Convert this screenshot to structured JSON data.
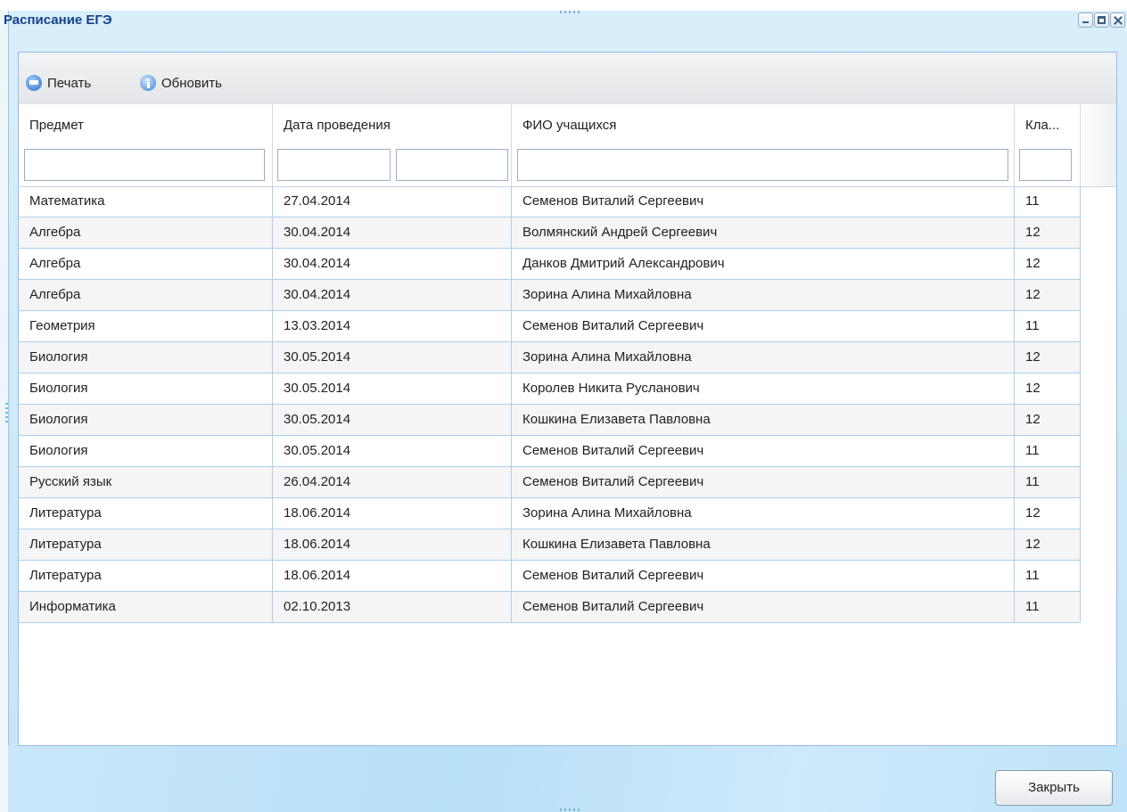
{
  "window": {
    "title": "Расписание ЕГЭ"
  },
  "toolbar": {
    "print_label": "Печать",
    "refresh_label": "Обновить"
  },
  "grid": {
    "columns": [
      "Предмет",
      "Дата проведения",
      "ФИО учащихся",
      "Кла..."
    ],
    "filters": {
      "subject": "",
      "date_from": "",
      "date_to": "",
      "student": "",
      "class": ""
    },
    "rows": [
      {
        "subject": "Математика",
        "date": "27.04.2014",
        "student": "Семенов Виталий Сергеевич",
        "class": "11"
      },
      {
        "subject": "Алгебра",
        "date": "30.04.2014",
        "student": "Волмянский Андрей Сергеевич",
        "class": "12"
      },
      {
        "subject": "Алгебра",
        "date": "30.04.2014",
        "student": "Данков Дмитрий Александрович",
        "class": "12"
      },
      {
        "subject": "Алгебра",
        "date": "30.04.2014",
        "student": "Зорина Алина Михайловна",
        "class": "12"
      },
      {
        "subject": "Геометрия",
        "date": "13.03.2014",
        "student": "Семенов Виталий Сергеевич",
        "class": "11"
      },
      {
        "subject": "Биология",
        "date": "30.05.2014",
        "student": "Зорина Алина Михайловна",
        "class": "12"
      },
      {
        "subject": "Биология",
        "date": "30.05.2014",
        "student": "Королев Никита Русланович",
        "class": "12"
      },
      {
        "subject": "Биология",
        "date": "30.05.2014",
        "student": "Кошкина Елизавета Павловна",
        "class": "12"
      },
      {
        "subject": "Биология",
        "date": "30.05.2014",
        "student": "Семенов Виталий Сергеевич",
        "class": "11"
      },
      {
        "subject": "Русский язык",
        "date": "26.04.2014",
        "student": "Семенов Виталий Сергеевич",
        "class": "11"
      },
      {
        "subject": "Литература",
        "date": "18.06.2014",
        "student": "Зорина Алина Михайловна",
        "class": "12"
      },
      {
        "subject": "Литература",
        "date": "18.06.2014",
        "student": "Кошкина Елизавета Павловна",
        "class": "12"
      },
      {
        "subject": "Литература",
        "date": "18.06.2014",
        "student": "Семенов Виталий Сергеевич",
        "class": "11"
      },
      {
        "subject": "Информатика",
        "date": "02.10.2013",
        "student": "Семенов Виталий Сергеевич",
        "class": "11"
      }
    ]
  },
  "footer": {
    "close_label": "Закрыть"
  },
  "icons": {
    "print": "printer-icon",
    "refresh": "info-refresh-icon",
    "minimize": "minimize-icon",
    "maximize": "maximize-icon",
    "close": "close-icon"
  },
  "colors": {
    "title": "#15428b",
    "row_border": "#a9d0ee",
    "window_bg": "#cde8f8"
  }
}
